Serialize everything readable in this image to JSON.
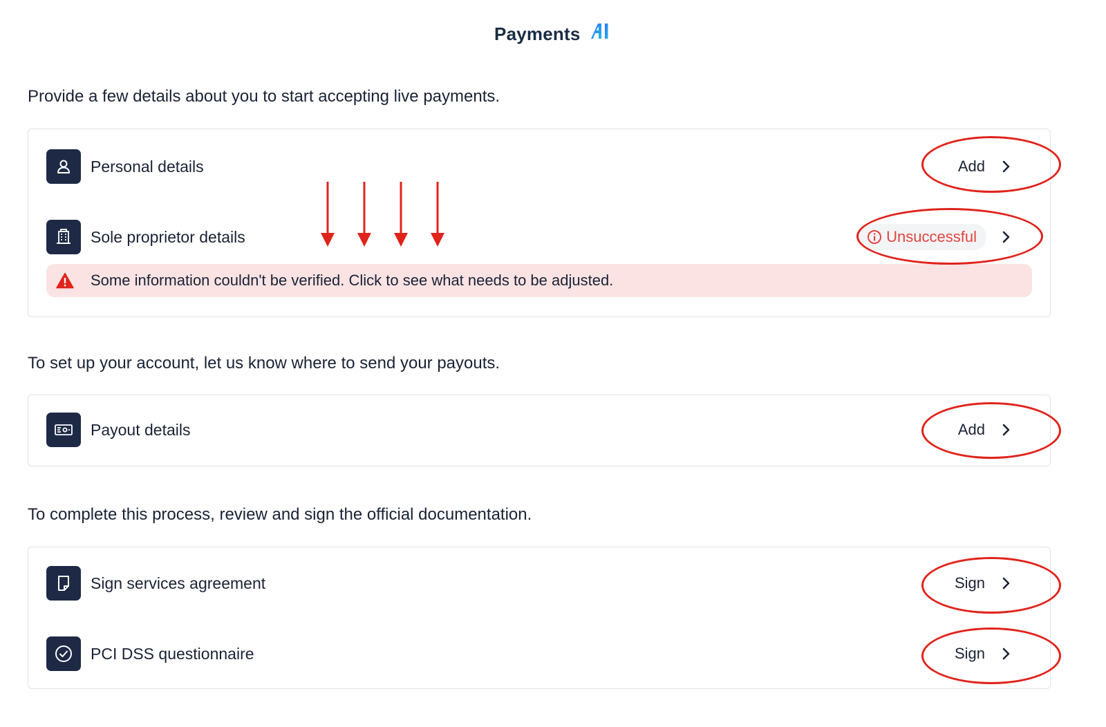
{
  "brand": {
    "name": "Payments",
    "suffix": "AI"
  },
  "sections": [
    {
      "heading": "Provide a few details about you to start accepting live payments.",
      "rows": [
        {
          "label": "Personal details",
          "icon": "person-icon",
          "action": "Add"
        },
        {
          "label": "Sole proprietor details",
          "icon": "building-icon",
          "status": "Unsuccessful"
        }
      ],
      "alert": "Some information couldn't be verified. Click to see what needs to be adjusted."
    },
    {
      "heading": "To set up your account, let us know where to send your payouts.",
      "rows": [
        {
          "label": "Payout details",
          "icon": "banknote-icon",
          "action": "Add"
        }
      ]
    },
    {
      "heading": "To complete this process, review and sign the official documentation.",
      "rows": [
        {
          "label": "Sign services agreement",
          "icon": "document-icon",
          "action": "Sign"
        },
        {
          "label": "PCI DSS questionnaire",
          "icon": "check-circle-icon",
          "action": "Sign"
        }
      ]
    }
  ],
  "colors": {
    "icon_bg": "#1e2a45",
    "error": "#e1453f",
    "alert_bg": "#fbe3e3",
    "annotation": "#e0231b",
    "border": "#dfe2e7"
  }
}
